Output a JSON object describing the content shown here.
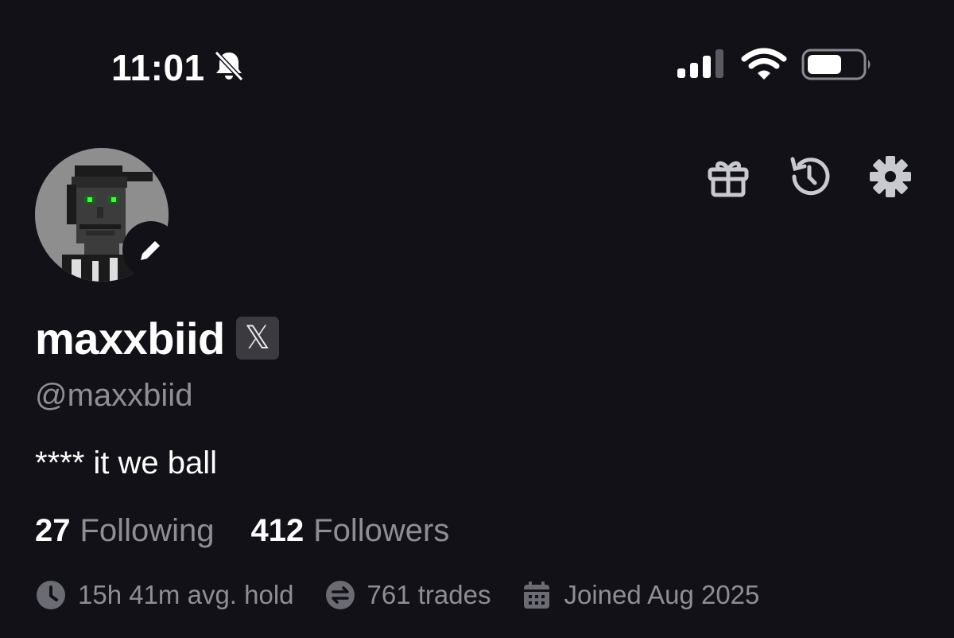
{
  "status_bar": {
    "time": "11:01",
    "icons": [
      "bell-slash-icon",
      "cellular-signal-icon",
      "wifi-icon",
      "battery-icon"
    ]
  },
  "toolbar": {
    "icons": [
      "gift-icon",
      "history-icon",
      "settings-gear-icon"
    ]
  },
  "profile": {
    "display_name": "maxxbiid",
    "x_badge": "𝕏",
    "handle": "@maxxbiid",
    "bio": "**** it we ball",
    "stats": [
      {
        "value": "27",
        "label": "Following"
      },
      {
        "value": "412",
        "label": "Followers"
      }
    ],
    "meta": {
      "hold": "15h 41m avg. hold",
      "trades": "761 trades",
      "joined": "Joined Aug 2025"
    }
  },
  "colors": {
    "background": "#121118",
    "muted_text": "#8e8e96",
    "icon_gray": "#c9c9d0",
    "avatar_eyes": "#3cff3c"
  }
}
